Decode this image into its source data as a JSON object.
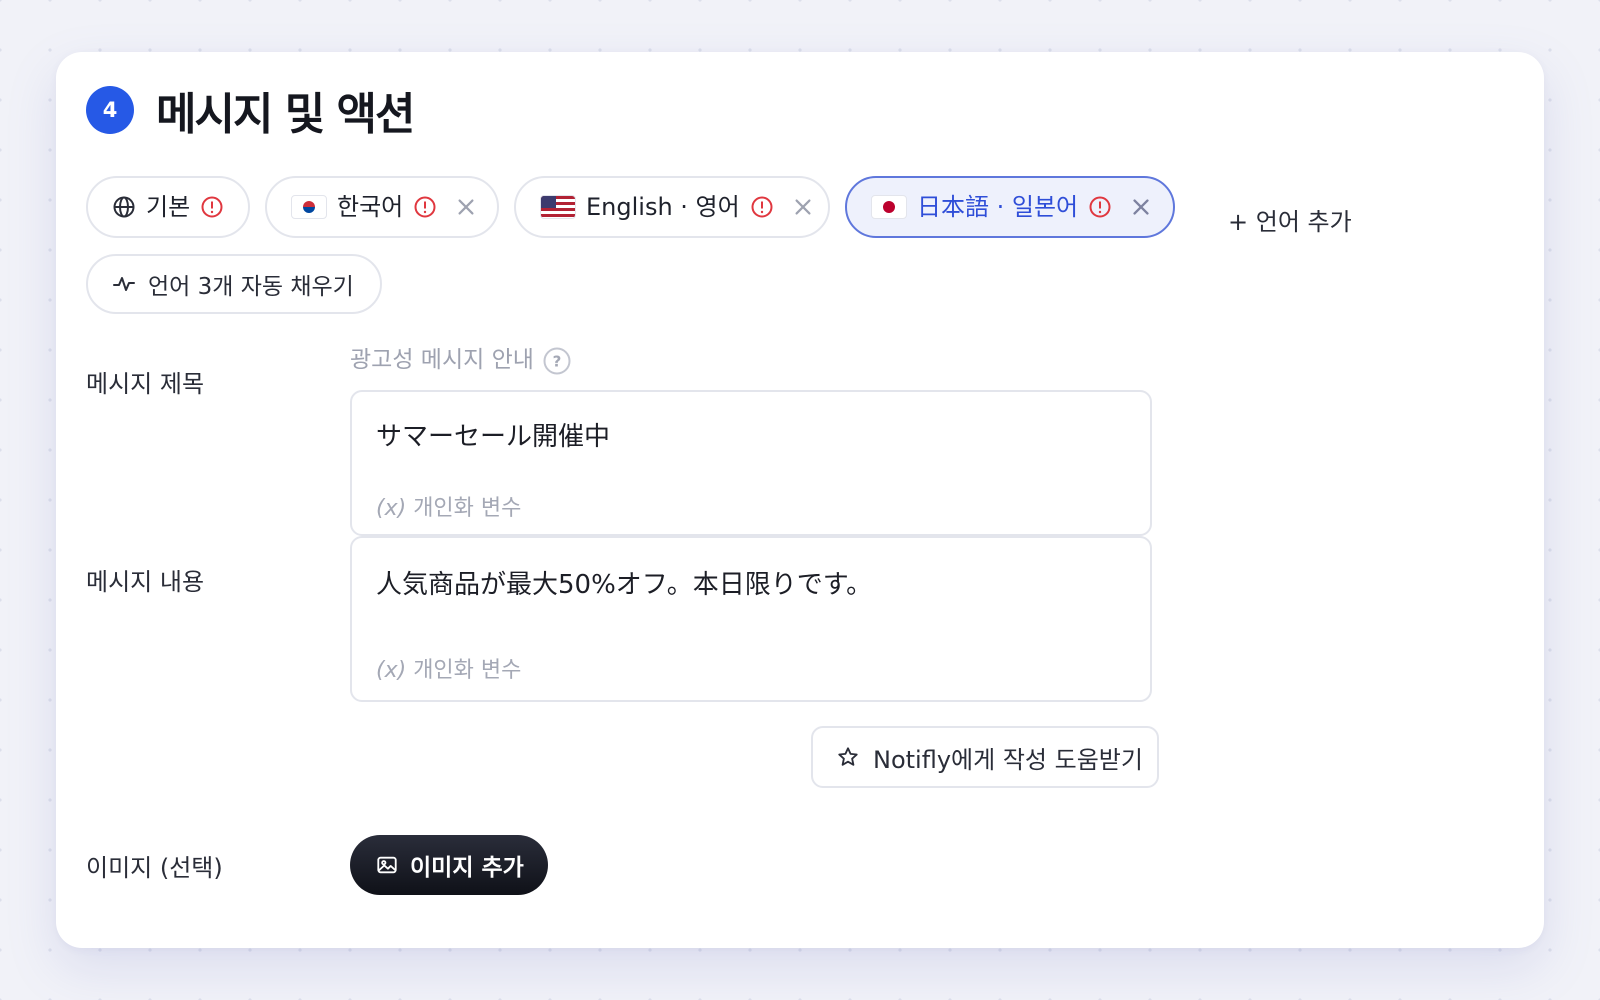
{
  "section": {
    "step": "4",
    "title": "메시지 및 액션"
  },
  "languages": {
    "tabs": [
      {
        "label": "기본"
      },
      {
        "label": "한국어"
      },
      {
        "label": "English · 영어"
      },
      {
        "label": "日本語 · 일본어"
      }
    ],
    "add_label": "+ 언어 추가",
    "autofill_label": "언어 3개 자동 채우기"
  },
  "form": {
    "ad_notice": "광고성 메시지 안내",
    "title_label": "메시지 제목",
    "title_value": "サマーセール開催中",
    "body_label": "메시지 내용",
    "body_value": "人気商品が最大50%オフ。本日限りです。",
    "var_prefix": "(x)",
    "var_label": "개인화 변수",
    "ai_help_label": "Notifly에게 작성 도움받기",
    "image_label": "이미지 (선택)",
    "image_button_label": "이미지 추가"
  },
  "colors": {
    "accent": "#2659e6",
    "active_tab": "#2f4ed8",
    "warning": "#e0373f"
  },
  "icons": [
    "globe-icon",
    "warning-icon",
    "close-icon",
    "pulse-icon",
    "help-icon",
    "star-icon",
    "image-icon"
  ]
}
